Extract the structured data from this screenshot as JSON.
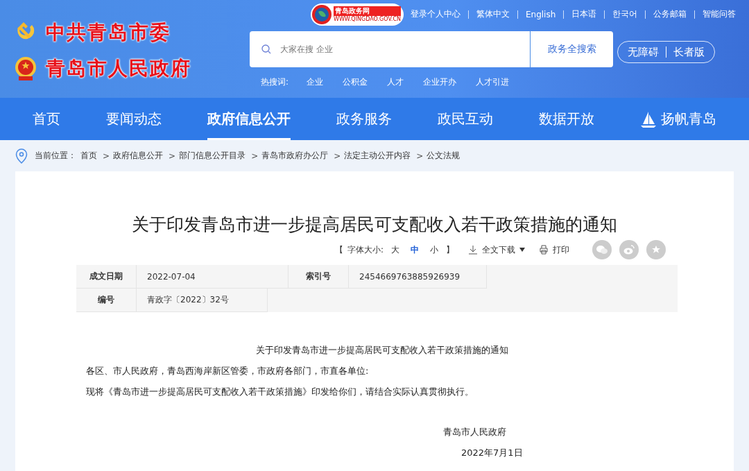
{
  "header": {
    "titles": [
      "中共青岛市委",
      "青岛市人民政府"
    ],
    "portal_logo": {
      "name": "青岛政务网",
      "url": "WWW.QINGDAO.GOV.CN"
    },
    "top_links": [
      "登录个人中心",
      "繁体中文",
      "English",
      "日本语",
      "한국어",
      "公务邮箱",
      "智能问答"
    ],
    "search": {
      "placeholder": "大家在搜 企业",
      "button": "政务全搜索"
    },
    "access": [
      "无障碍",
      "长者版"
    ],
    "hot_label": "热搜词:",
    "hot_words": [
      "企业",
      "公积金",
      "人才",
      "企业开办",
      "人才引进"
    ]
  },
  "nav": [
    {
      "label": "首页",
      "selected": false
    },
    {
      "label": "要闻动态",
      "selected": false
    },
    {
      "label": "政府信息公开",
      "selected": true
    },
    {
      "label": "政务服务",
      "selected": false
    },
    {
      "label": "政民互动",
      "selected": false
    },
    {
      "label": "数据开放",
      "selected": false
    },
    {
      "label": "扬帆青岛",
      "selected": false
    }
  ],
  "breadcrumb": {
    "label": "当前位置：",
    "separator": ">",
    "items": [
      "首页",
      "政府信息公开",
      "部门信息公开目录",
      "青岛市政府办公厅",
      "法定主动公开内容",
      "公文法规"
    ]
  },
  "article": {
    "title": "关于印发青岛市进一步提高居民可支配收入若干政策措施的通知",
    "font_size": {
      "open": "【",
      "label": "字体大小:",
      "options": [
        {
          "label": "大",
          "selected": false
        },
        {
          "label": "中",
          "selected": true
        },
        {
          "label": "小",
          "selected": false
        }
      ],
      "close": "】"
    },
    "download": "全文下载",
    "print": "打印",
    "meta": [
      {
        "label": "成文日期",
        "value": "2022-07-04"
      },
      {
        "label": "索引号",
        "value": "2454669763885926939"
      },
      {
        "label": "编号",
        "value": "青政字〔2022〕32号"
      }
    ],
    "body": {
      "heading": "关于印发青岛市进一步提高居民可支配收入若干政策措施的通知",
      "salutation": "各区、市人民政府，青岛西海岸新区管委，市政府各部门，市直各单位:",
      "paragraph": "现将《青岛市进一步提高居民可支配收入若干政策措施》印发给你们，请结合实际认真贯彻执行。",
      "signer": "青岛市人民政府",
      "date": "2022年7月1日"
    }
  }
}
